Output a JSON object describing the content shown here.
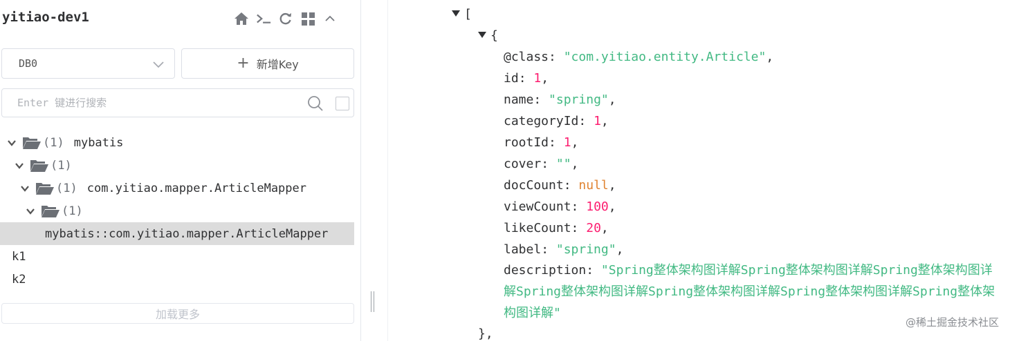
{
  "connection": {
    "title": "yitiao-dev1",
    "toolbar_icons": [
      "home-icon",
      "terminal-icon",
      "refresh-icon",
      "grid-icon",
      "chevron-up-icon"
    ]
  },
  "db_select": {
    "value": "DB0"
  },
  "add_key": {
    "label": "新增Key"
  },
  "search": {
    "placeholder": "Enter 键进行搜索"
  },
  "tree": {
    "rows": [
      {
        "count": "(1)",
        "label": "mybatis"
      },
      {
        "count": "(1)",
        "label": ""
      },
      {
        "count": "(1)",
        "label": "com.yitiao.mapper.ArticleMapper"
      },
      {
        "count": "(1)",
        "label": ""
      },
      {
        "label": "mybatis::com.yitiao.mapper.ArticleMapper"
      },
      {
        "label": "k1"
      },
      {
        "label": "k2"
      }
    ]
  },
  "load_more": "加载更多",
  "json_view": {
    "open_bracket": "[",
    "open_brace": "{",
    "fields": [
      {
        "key": "@class",
        "value": "\"com.yitiao.entity.Article\"",
        "type": "string"
      },
      {
        "key": "id",
        "value": "1",
        "type": "number"
      },
      {
        "key": "name",
        "value": "\"spring\"",
        "type": "string"
      },
      {
        "key": "categoryId",
        "value": "1",
        "type": "number"
      },
      {
        "key": "rootId",
        "value": "1",
        "type": "number"
      },
      {
        "key": "cover",
        "value": "\"\"",
        "type": "string"
      },
      {
        "key": "docCount",
        "value": "null",
        "type": "null"
      },
      {
        "key": "viewCount",
        "value": "100",
        "type": "number"
      },
      {
        "key": "likeCount",
        "value": "20",
        "type": "number"
      },
      {
        "key": "label",
        "value": "\"spring\"",
        "type": "string"
      }
    ],
    "description": {
      "key": "description",
      "value": "\"Spring整体架构图详解Spring整体架构图详解Spring整体架构图详解Spring整体架构图详解Spring整体架构图详解Spring整体架构图详解Spring整体架构图详解\""
    },
    "close_brace": "},"
  },
  "watermark": "@稀土掘金技术社区",
  "colors": {
    "string": "#42b983",
    "number": "#fc1e70",
    "null": "#e08331",
    "selected_row": "#dcdcdc"
  }
}
